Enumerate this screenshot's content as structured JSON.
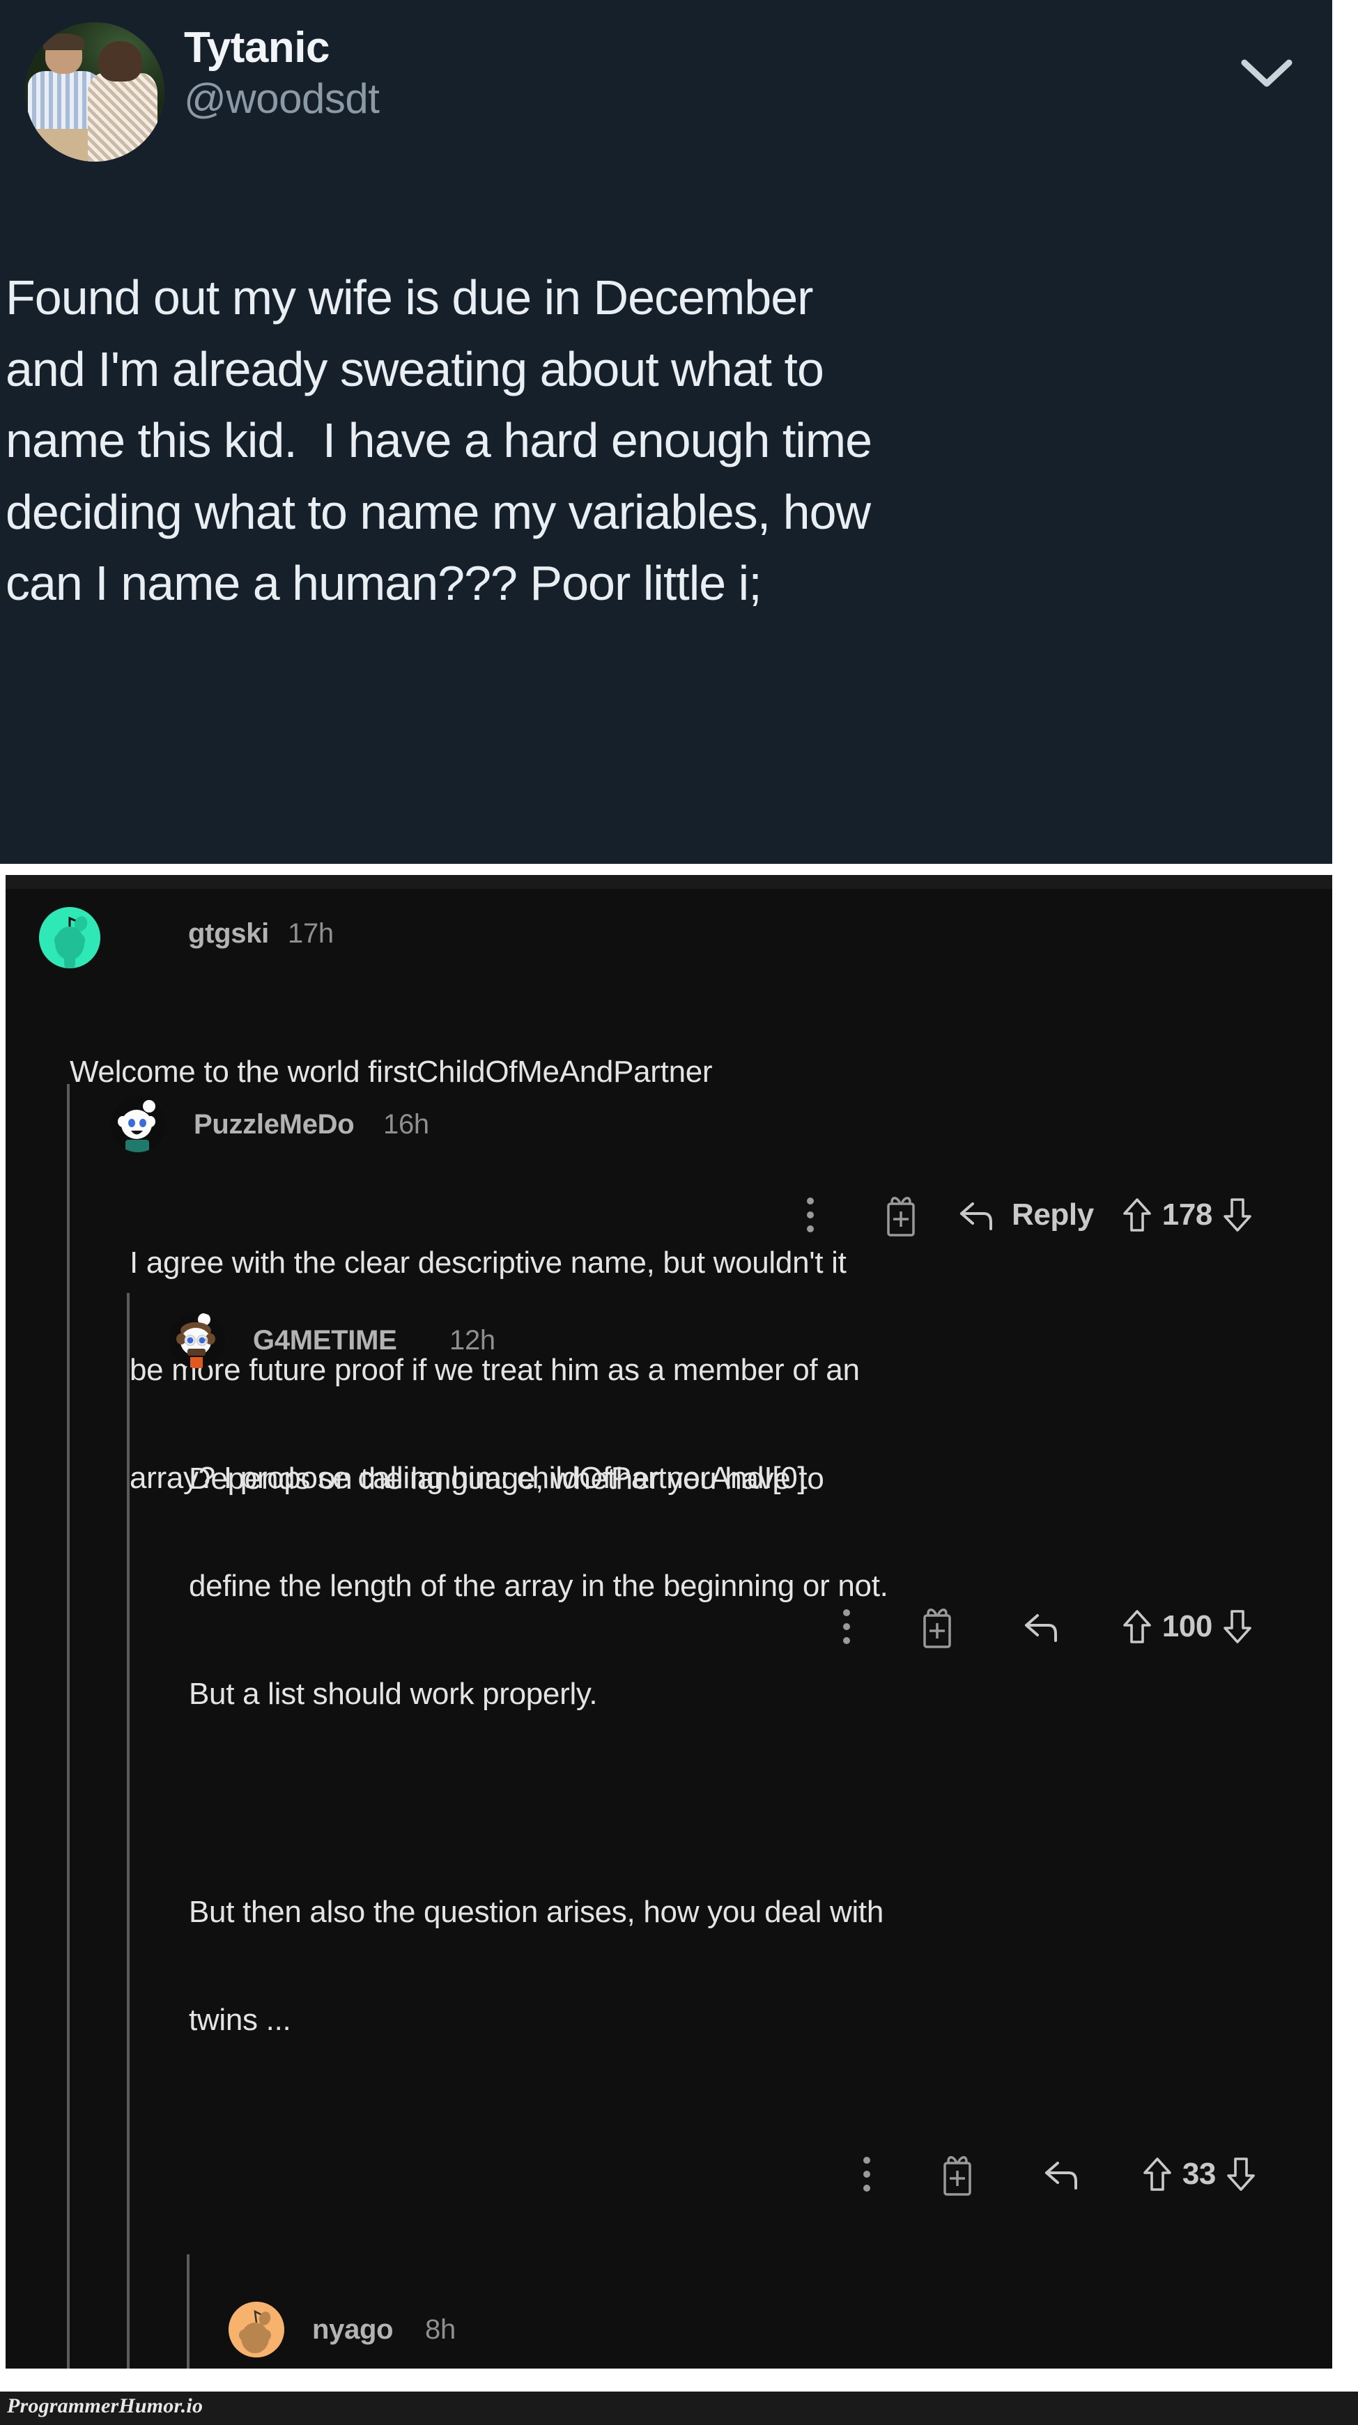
{
  "tweet": {
    "display_name": "Tytanic",
    "handle": "@woodsdt",
    "chevron_icon": "chevron-down-icon",
    "avatar_alt": "couple-photo-avatar",
    "body_lines": [
      "Found out my wife is due in December",
      "and I'm already sweating about what to",
      "name this kid.  I have a hard enough time",
      "deciding what to name my variables, how",
      "can I name a human??? Poor little i;"
    ],
    "full_text": "Found out my wife is due in December and I'm already sweating about what to name this kid.  I have a hard enough time deciding what to name my variables, how can I name a human??? Poor little i;"
  },
  "reddit": {
    "comments": [
      {
        "username": "gtgski",
        "time": "17h",
        "avatar": "snoo-avatar-teal",
        "body_lines": [
          "Welcome to the world firstChildOfMeAndPartner"
        ],
        "actions": {
          "kebab_icon": "more-options-icon",
          "award_icon": "give-award-icon",
          "reply_icon": "reply-arrow-icon",
          "reply_label": "Reply",
          "upvote_icon": "upvote-arrow-icon",
          "downvote_icon": "downvote-arrow-icon",
          "score": "178"
        }
      },
      {
        "username": "PuzzleMeDo",
        "time": "16h",
        "avatar": "snoo-avatar-white",
        "body_lines": [
          "I agree with the clear descriptive name, but wouldn't it",
          "be more future proof if we treat him as a member of an",
          "array? I propose calling him: childOfPartnerAndI[0]"
        ],
        "actions": {
          "kebab_icon": "more-options-icon",
          "award_icon": "give-award-icon",
          "reply_icon": "reply-arrow-icon",
          "reply_label": "",
          "upvote_icon": "upvote-arrow-icon",
          "downvote_icon": "downvote-arrow-icon",
          "score": "100"
        }
      },
      {
        "username": "G4METIME",
        "time": "12h",
        "avatar": "snoo-avatar-brown",
        "body_lines": [
          "Depends on the language, whether you have to",
          "define the length of the array in the beginning or not.",
          "But a list should work properly."
        ],
        "body_lines_2": [
          "But then also the question arises, how you deal with",
          "twins ..."
        ],
        "actions": {
          "kebab_icon": "more-options-icon",
          "award_icon": "give-award-icon",
          "reply_icon": "reply-arrow-icon",
          "reply_label": "",
          "upvote_icon": "upvote-arrow-icon",
          "downvote_icon": "downvote-arrow-icon",
          "score": "33"
        }
      },
      {
        "username": "nyago",
        "time": "8h",
        "avatar": "snoo-avatar-orange",
        "body_lines": []
      }
    ]
  },
  "watermark": {
    "label": "ProgrammerHumor.io"
  },
  "colors": {
    "tweet_bg": "#15202b",
    "reddit_bg": "#0f0f0f",
    "accent_teal": "#2ee8b5",
    "accent_orange": "#f5b06a",
    "text_primary": "#e4e4e4",
    "text_muted": "#8f8f8f"
  }
}
